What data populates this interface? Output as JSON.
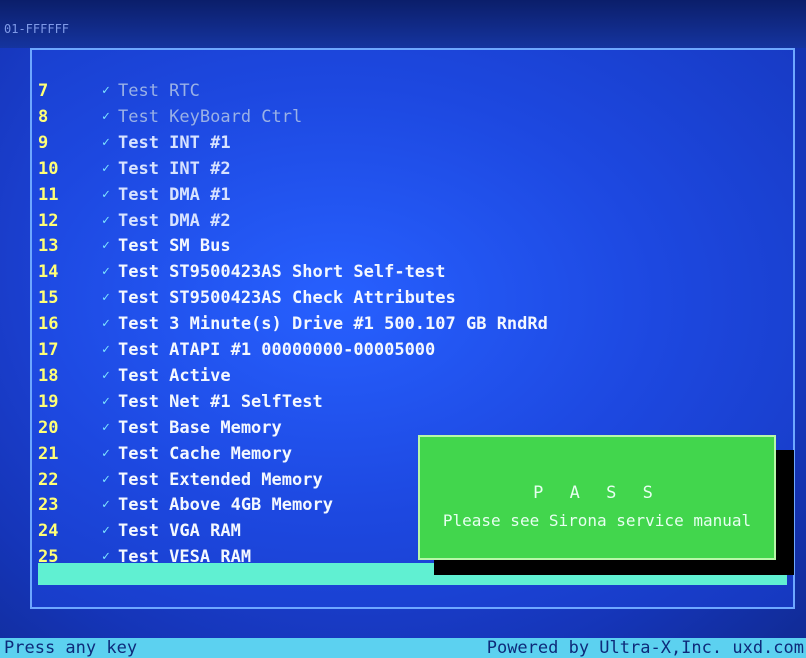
{
  "window": {
    "corner_label": "01-FFFFFF"
  },
  "tests": [
    {
      "num": "7",
      "label": "Test RTC"
    },
    {
      "num": "8",
      "label": "Test KeyBoard Ctrl"
    },
    {
      "num": "9",
      "label": "Test INT #1"
    },
    {
      "num": "10",
      "label": "Test INT #2"
    },
    {
      "num": "11",
      "label": "Test DMA #1"
    },
    {
      "num": "12",
      "label": "Test DMA #2"
    },
    {
      "num": "13",
      "label": "Test SM Bus"
    },
    {
      "num": "14",
      "label": "Test ST9500423AS Short Self-test"
    },
    {
      "num": "15",
      "label": "Test ST9500423AS Check Attributes"
    },
    {
      "num": "16",
      "label": "Test 3 Minute(s) Drive #1 500.107 GB RndRd"
    },
    {
      "num": "17",
      "label": "Test ATAPI #1 00000000-00005000"
    },
    {
      "num": "18",
      "label": "Test Active"
    },
    {
      "num": "19",
      "label": "Test Net #1 SelfTest"
    },
    {
      "num": "20",
      "label": "Test Base Memory"
    },
    {
      "num": "21",
      "label": "Test Cache Memory"
    },
    {
      "num": "22",
      "label": "Test Extended Memory"
    },
    {
      "num": "23",
      "label": "Test Above 4GB Memory"
    },
    {
      "num": "24",
      "label": "Test VGA  RAM"
    },
    {
      "num": "25",
      "label": "Test VESA RAM"
    }
  ],
  "check_mark": "✓",
  "progress": {
    "fraction": 1.0
  },
  "result": {
    "title": "P A S S",
    "message": "Please see Sirona service manual"
  },
  "status_bar": {
    "left": "Press any key",
    "right": "Powered by Ultra-X,Inc. uxd.com"
  },
  "colors": {
    "background": "#1d48e0",
    "pass_box": "#42d64d",
    "status_bar": "#5cd1f0",
    "number": "#ffff77"
  }
}
